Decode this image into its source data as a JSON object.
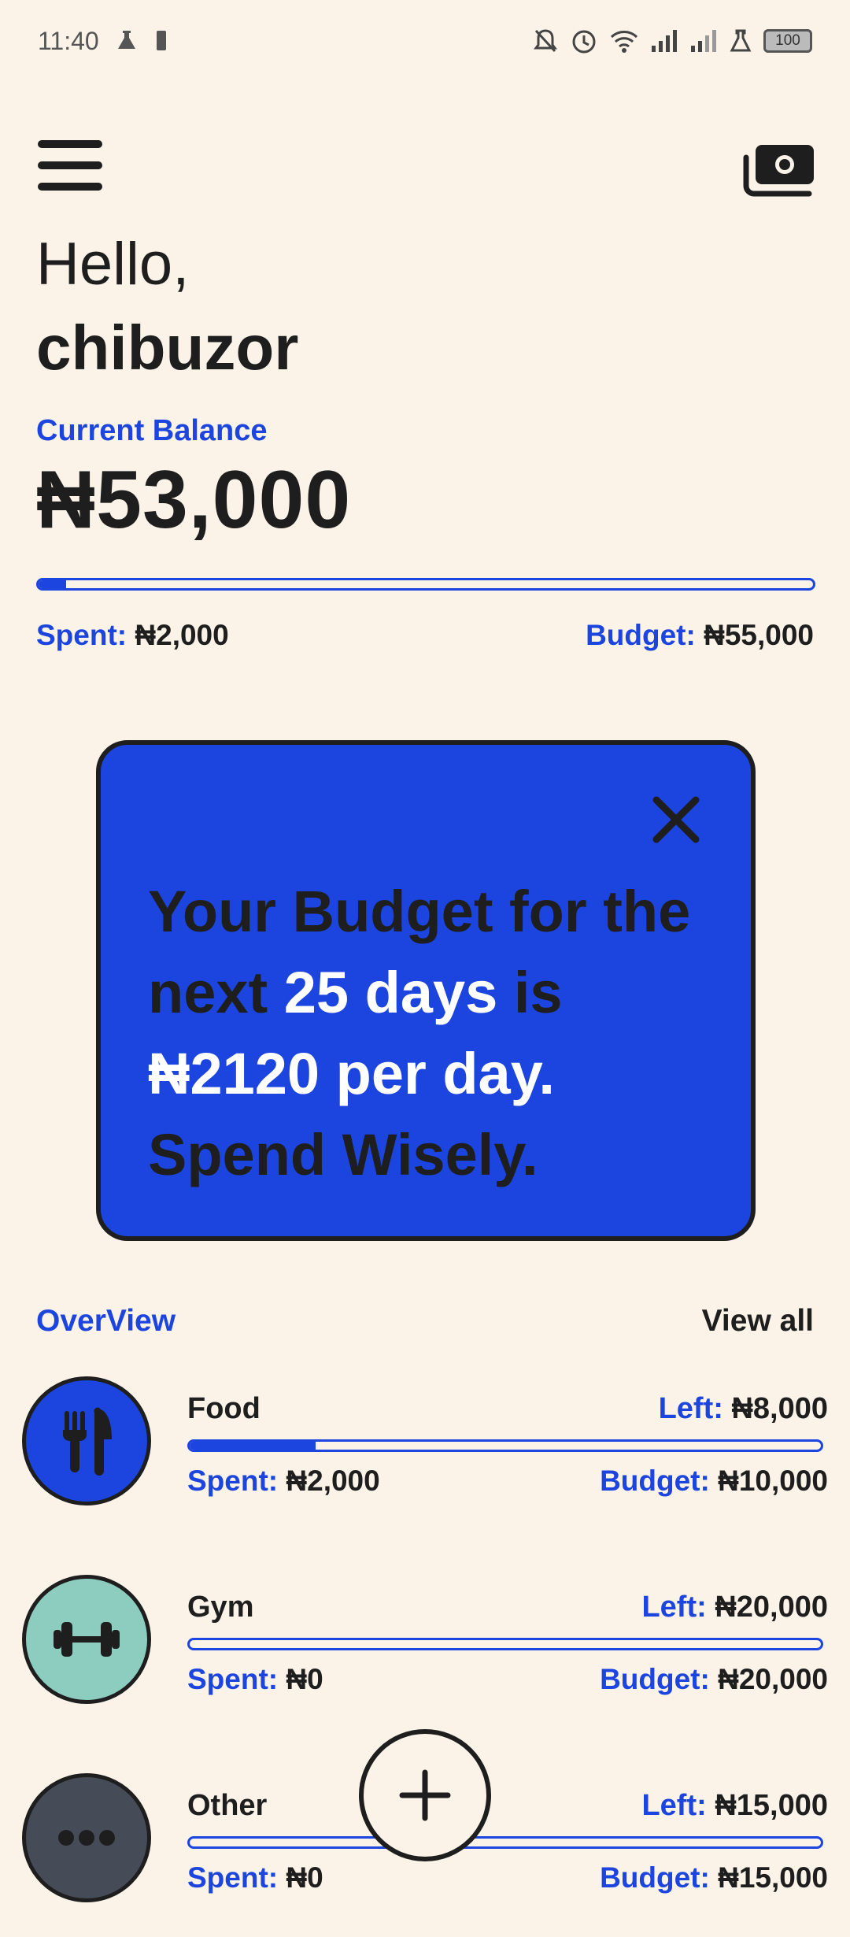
{
  "status_bar": {
    "time": "11:40",
    "battery": "100",
    "left_icons": [
      "flask-icon",
      "battery-small-icon"
    ],
    "right_icons": [
      "bell-off-icon",
      "alarm-icon",
      "wifi-icon",
      "signal-icon",
      "signal-icon",
      "flask-icon"
    ]
  },
  "header": {
    "greeting": "Hello,",
    "username": "chibuzor",
    "menu_icon": "hamburger-menu-icon",
    "money_icon": "cash-stack-icon"
  },
  "balance": {
    "label": "Current Balance",
    "value": "₦53,000",
    "spent_label": "Spent:",
    "spent_value": "₦2,000",
    "budget_label": "Budget:",
    "budget_value": "₦55,000",
    "spent_fraction": 0.036
  },
  "budget_card": {
    "text_1": "Your Budget for the next ",
    "highlight_days": "25 days",
    "text_2": " is ",
    "highlight_amount": "₦2120 per day.",
    "text_3": " Spend Wisely.",
    "close_icon": "close-icon"
  },
  "overview": {
    "title": "OverView",
    "view_all": "View all",
    "categories": [
      {
        "name": "Food",
        "icon": "fork-knife-icon",
        "color": "#1B45DE",
        "left_label": "Left:",
        "left_value": "₦8,000",
        "spent_label": "Spent:",
        "spent_value": "₦2,000",
        "budget_label": "Budget:",
        "budget_value": "₦10,000",
        "spent_fraction": 0.2
      },
      {
        "name": "Gym",
        "icon": "dumbbell-icon",
        "color": "#8CCDC0",
        "left_label": "Left:",
        "left_value": "₦20,000",
        "spent_label": "Spent:",
        "spent_value": "₦0",
        "budget_label": "Budget:",
        "budget_value": "₦20,000",
        "spent_fraction": 0
      },
      {
        "name": "Other",
        "icon": "more-dots-icon",
        "color": "#454B57",
        "left_label": "Left:",
        "left_value": "₦15,000",
        "spent_label": "Spent:",
        "spent_value": "₦0",
        "budget_label": "Budget:",
        "budget_value": "₦15,000",
        "spent_fraction": 0
      }
    ]
  },
  "fab": {
    "icon": "plus-icon"
  },
  "colors": {
    "background": "#FBF3E8",
    "accent": "#1B45DE",
    "text": "#1E1E1E"
  }
}
